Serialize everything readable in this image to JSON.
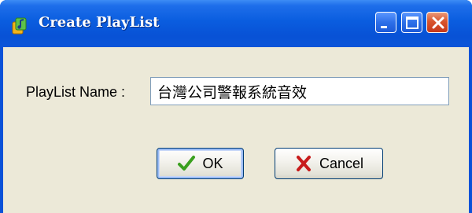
{
  "window": {
    "title": "Create PlayList",
    "icon": "music-notes-icon",
    "controls": {
      "minimize_icon": "minimize-icon",
      "maximize_icon": "maximize-icon",
      "close_icon": "close-icon"
    }
  },
  "form": {
    "name_label": "PlayList Name :",
    "name_value": "台灣公司警報系統音效",
    "name_placeholder": ""
  },
  "buttons": {
    "ok_label": "OK",
    "ok_icon": "checkmark-icon",
    "cancel_label": "Cancel",
    "cancel_icon": "x-icon"
  },
  "colors": {
    "titlebar": "#0a5ddf",
    "client_bg": "#ece9d8",
    "close_button": "#d9542c",
    "ok_check": "#3aa01e",
    "cancel_x": "#c81c1c"
  }
}
